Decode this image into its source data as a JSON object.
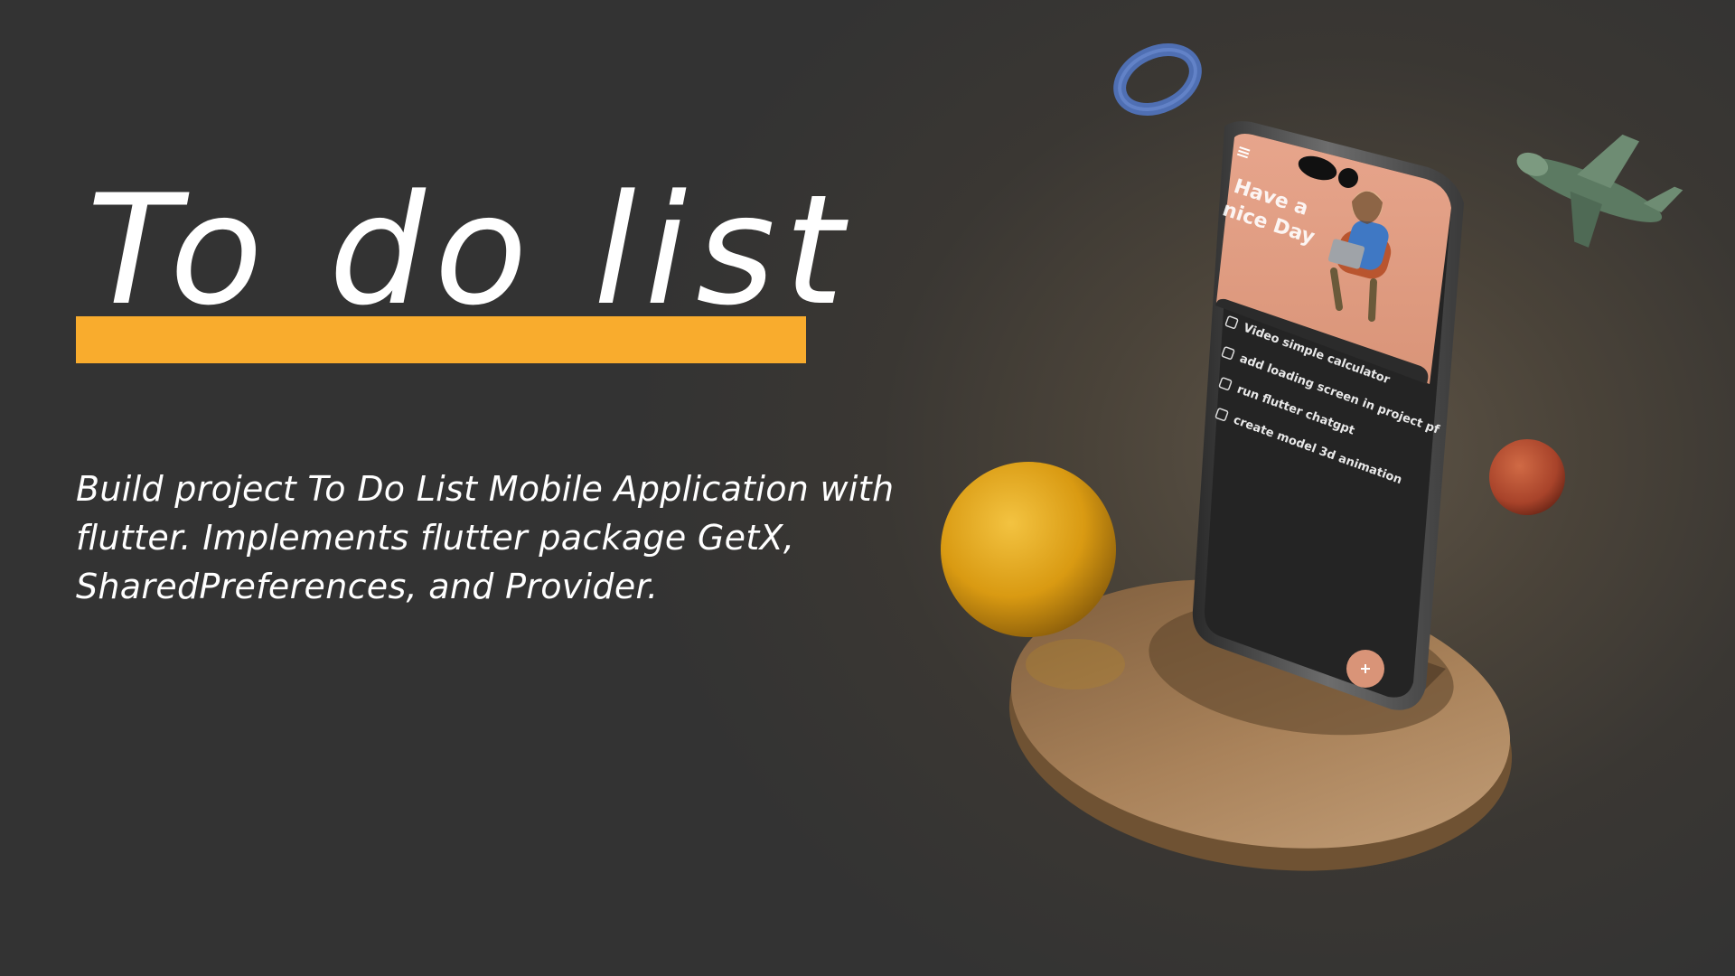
{
  "title": "To do list",
  "description": "Build project To Do List Mobile Application with flutter. Implements flutter package GetX, SharedPreferences, and Provider.",
  "colors": {
    "background": "#333333",
    "accent": "#f9ac2d",
    "text": "#ffffff"
  },
  "phone": {
    "greeting_line1": "Have a",
    "greeting_line2": "nice Day",
    "menu_icon": "hamburger-icon",
    "fab_icon": "plus-icon",
    "tasks": [
      {
        "label": "Video simple calculator",
        "checked": false
      },
      {
        "label": "add loading screen in project pf",
        "checked": false
      },
      {
        "label": "run flutter chatgpt",
        "checked": false
      },
      {
        "label": "create model 3d animation",
        "checked": false
      }
    ]
  },
  "decor": {
    "ring": "ring-shape",
    "sphere_yellow": "sphere-shape",
    "sphere_red": "sphere-shape",
    "airplane": "airplane-icon",
    "pedestal": "pedestal-shape"
  }
}
